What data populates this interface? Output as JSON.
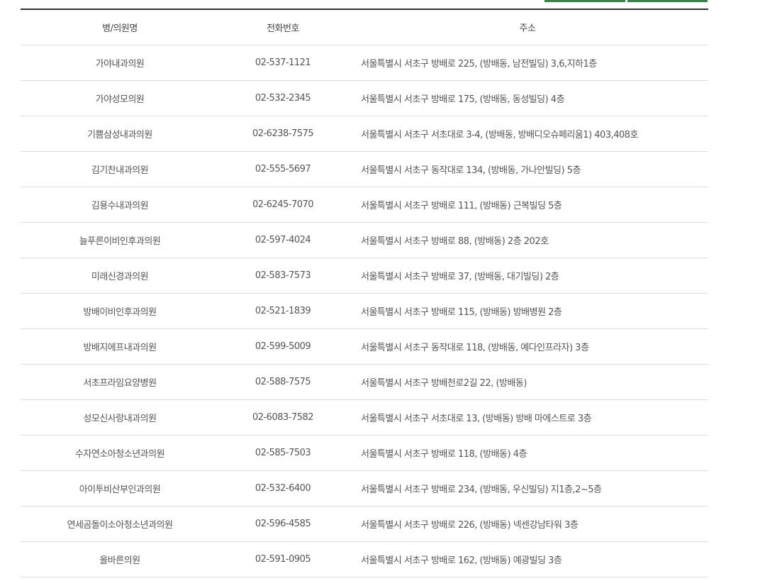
{
  "table": {
    "headers": {
      "name": "병/의원명",
      "tel": "전화번호",
      "addr": "주소"
    },
    "rows": [
      {
        "name": "가야내과의원",
        "tel": "02-537-1121",
        "addr": "서울특별시 서초구 방배로 225, (방배동, 남전빌딩) 3,6,지하1층"
      },
      {
        "name": "가야성모의원",
        "tel": "02-532-2345",
        "addr": "서울특별시 서초구 방배로 175, (방배동, 동성빌딩) 4층"
      },
      {
        "name": "기쁨삼성내과의원",
        "tel": "02-6238-7575",
        "addr": "서울특별시 서초구 서초대로 3-4, (방배동, 방배디오슈페리움1) 403,408호"
      },
      {
        "name": "김기찬내과의원",
        "tel": "02-555-5697",
        "addr": "서울특별시 서초구 동작대로 134, (방배동, 가나안빌딩) 5층"
      },
      {
        "name": "김용수내과의원",
        "tel": "02-6245-7070",
        "addr": "서울특별시 서초구 방배로 111, (방배동) 근복빌딩 5층"
      },
      {
        "name": "늘푸른이비인후과의원",
        "tel": "02-597-4024",
        "addr": "서울특별시 서초구 방배로 88, (방배동) 2층 202호"
      },
      {
        "name": "미래신경과의원",
        "tel": "02-583-7573",
        "addr": "서울특별시 서초구 방배로 37, (방배동, 대기빌딩) 2층"
      },
      {
        "name": "방배이비인후과의원",
        "tel": "02-521-1839",
        "addr": "서울특별시 서초구 방배로 115, (방배동) 방배병원 2층"
      },
      {
        "name": "방배지에프내과의원",
        "tel": "02-599-5009",
        "addr": "서울특별시 서초구 동작대로 118, (방배동, 예다인프라자) 3층"
      },
      {
        "name": "서초프라임요양병원",
        "tel": "02-588-7575",
        "addr": "서울특별시 서초구 방배천로2길 22, (방배동)"
      },
      {
        "name": "성모신사랑내과의원",
        "tel": "02-6083-7582",
        "addr": "서울특별시 서초구 서초대로 13, (방배동) 방배 마에스트로 3층"
      },
      {
        "name": "수자연소아청소년과의원",
        "tel": "02-585-7503",
        "addr": "서울특별시 서초구 방배로 118, (방배동) 4층"
      },
      {
        "name": "아이투비산부인과의원",
        "tel": "02-532-6400",
        "addr": "서울특별시 서초구 방배로 234, (방배동, 우신빌딩) 지1층,2~5층"
      },
      {
        "name": "연세곰돌이소아청소년과의원",
        "tel": "02-596-4585",
        "addr": "서울특별시 서초구 방배로 226, (방배동) 넥센강남타워 3층"
      },
      {
        "name": "올바른의원",
        "tel": "02-591-0905",
        "addr": "서울특별시 서초구 방배로 162, (방배동) 예광빌딩 3층"
      }
    ]
  },
  "colors": {
    "accent": "#2e8b3d",
    "header_border": "#333333",
    "row_border": "#dddddd",
    "text": "#555555"
  }
}
